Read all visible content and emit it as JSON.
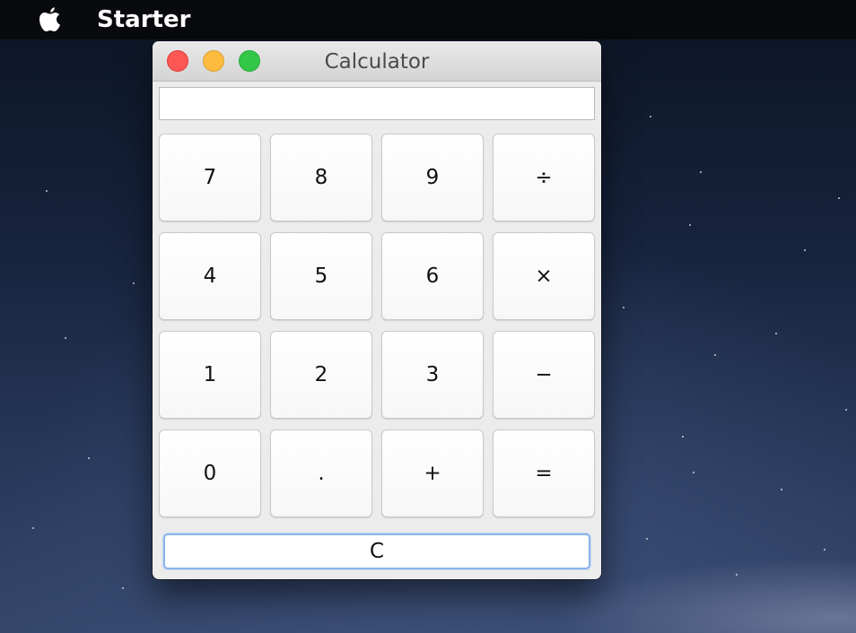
{
  "menubar": {
    "app_name": "Starter",
    "apple_icon": "apple-logo-icon"
  },
  "window": {
    "title": "Calculator",
    "controls": [
      "close",
      "minimize",
      "zoom"
    ]
  },
  "display": {
    "value": "",
    "placeholder": ""
  },
  "keypad": {
    "rows": [
      [
        "7",
        "8",
        "9",
        "÷"
      ],
      [
        "4",
        "5",
        "6",
        "×"
      ],
      [
        "1",
        "2",
        "3",
        "−"
      ],
      [
        "0",
        ".",
        "+",
        "="
      ]
    ]
  },
  "clear_label": "C",
  "colors": {
    "close": "#fc5753",
    "minimize": "#fdbc40",
    "zoom": "#33c748",
    "focus_ring": "#8fb4ea"
  }
}
